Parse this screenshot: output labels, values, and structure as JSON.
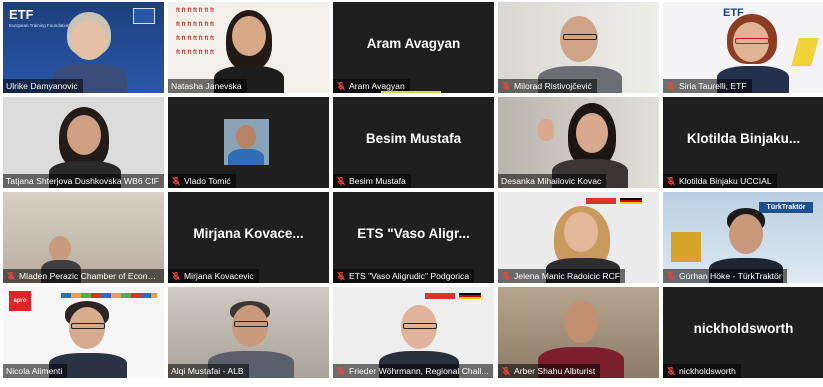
{
  "meeting": {
    "talk_indicator_color": "#d3d846",
    "muted_icon_color": "#e8463c",
    "tiles": [
      {
        "name": "Ulrike Damyanovic",
        "video": true,
        "muted": false,
        "logo_text": "ETF",
        "logo_subtext": "European Training Foundation"
      },
      {
        "name": "Natasha Janevska",
        "video": true,
        "muted": false
      },
      {
        "name": "Aram Avagyan",
        "video": false,
        "muted": true,
        "talking": true
      },
      {
        "name": "Milorad Ristivojčević",
        "video": true,
        "muted": true
      },
      {
        "name": "Siria Taurelli, ETF",
        "video": true,
        "muted": true,
        "logo_text": "ETF"
      },
      {
        "name": "Tatjana Shterjova Dushkovska WB6 CIF",
        "video": true,
        "muted": false
      },
      {
        "name": "Vlado Tomić",
        "video": true,
        "muted": true,
        "self_view": true
      },
      {
        "name": "Besim Mustafa",
        "video": false,
        "muted": true
      },
      {
        "name": "Desanka Mihailovic Kovac",
        "video": true,
        "muted": false
      },
      {
        "name": "Klotilda Binjaku UCCIAL",
        "big_label": "Klotilda Binjaku...",
        "video": false,
        "muted": true
      },
      {
        "name": "Mladen Perazic Chamber of Econo...",
        "video": true,
        "muted": true
      },
      {
        "name": "Mirjana Kovacevic",
        "big_label": "Mirjana Kovace...",
        "video": false,
        "muted": true
      },
      {
        "name": "ETS \"Vaso Aligrudic\" Podgorica",
        "big_label": "ETS \"Vaso Aligr...",
        "video": false,
        "muted": true
      },
      {
        "name": "Jelena Manic Radoicic RCF",
        "video": true,
        "muted": true
      },
      {
        "name": "Gürhan Höke - TürkTraktör",
        "video": true,
        "muted": true,
        "logo_text": "TürkTraktör"
      },
      {
        "name": "Nicola Alimenti",
        "video": true,
        "muted": false,
        "logo_text": "apro"
      },
      {
        "name": "Alqi Mustafai - ALB",
        "video": true,
        "muted": false,
        "active": true
      },
      {
        "name": "Frieder Wöhrmann, Regional Chall...",
        "video": true,
        "muted": true
      },
      {
        "name": "Arber Shahu Albturist",
        "video": true,
        "muted": true
      },
      {
        "name": "nickholdsworth",
        "video": false,
        "muted": true
      }
    ]
  }
}
